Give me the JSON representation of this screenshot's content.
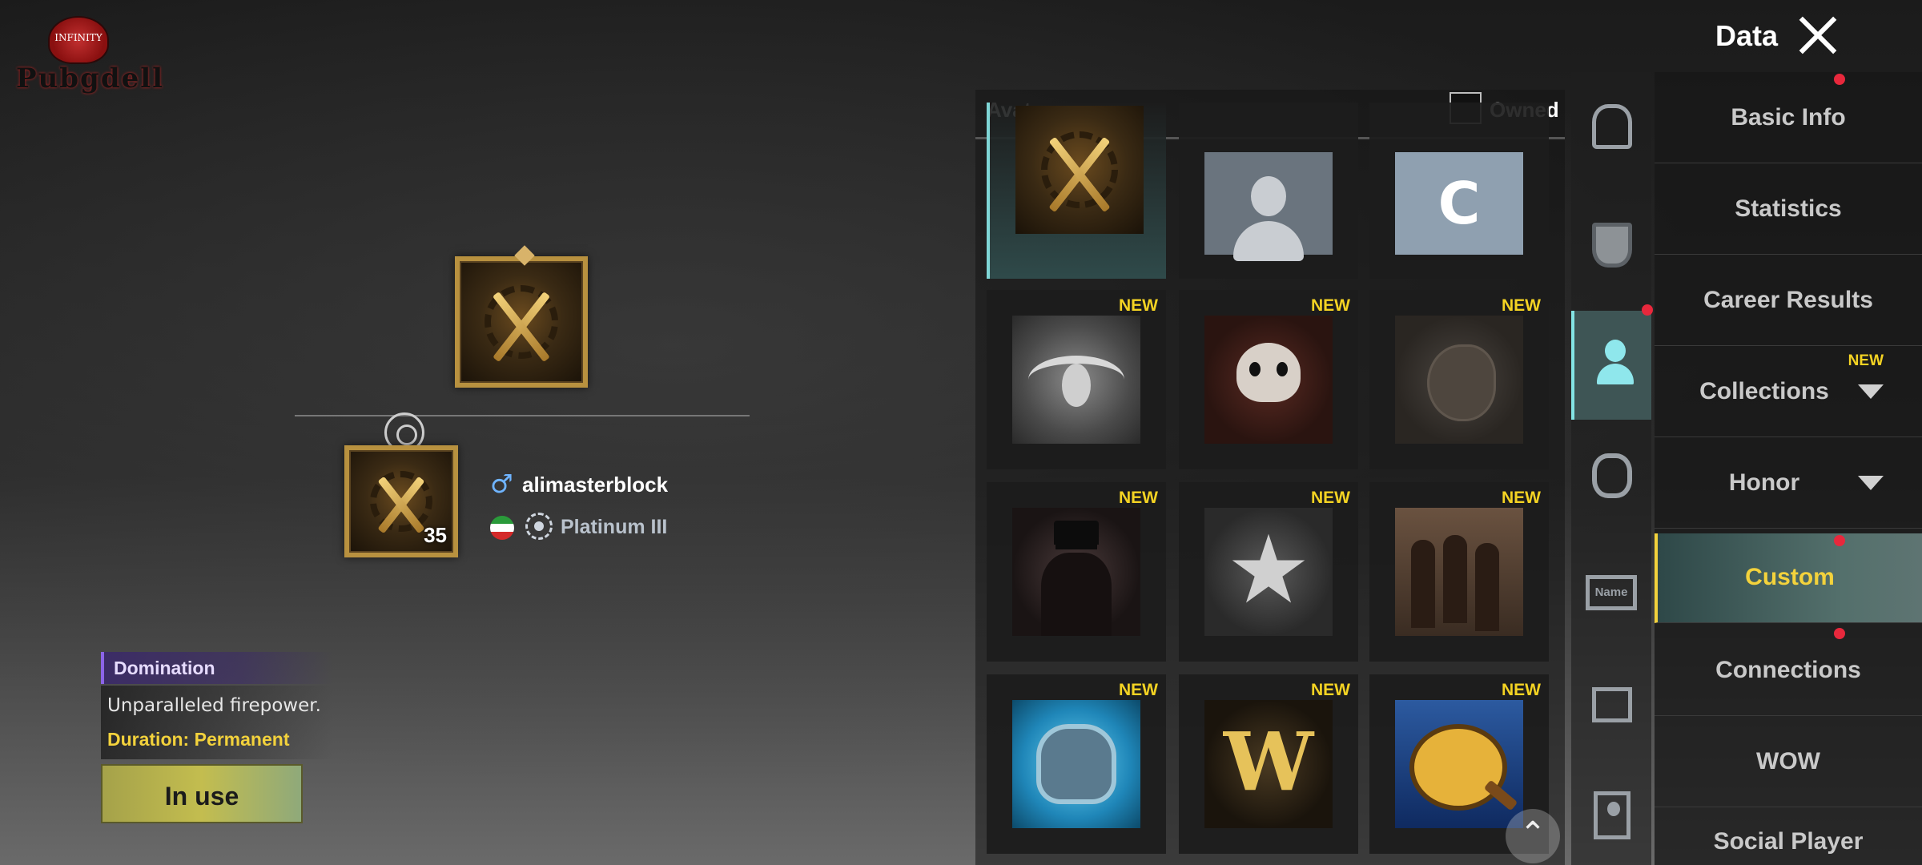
{
  "watermark": {
    "logo_seal": "INFINITY",
    "logo_word": "Pubgdell"
  },
  "header": {
    "title": "Data",
    "close_icon": "close-icon"
  },
  "preview": {
    "level": "35",
    "player_name": "alimasterblock",
    "gender_icon": "male-icon",
    "rank": "Platinum III"
  },
  "item": {
    "name": "Domination",
    "description": "Unparalleled firepower.",
    "duration": "Duration: Permanent",
    "button_label": "In use"
  },
  "avatar_panel": {
    "title": "Avatar",
    "owned_label": "Owned",
    "new_label": "NEW",
    "tiles": [
      {
        "art": "crossed-rifles-icon",
        "new": false,
        "selected": true
      },
      {
        "art": "default-person-icon",
        "new": false,
        "selected": false
      },
      {
        "art": "letter-c-icon",
        "letter": "C",
        "new": false,
        "selected": false
      },
      {
        "art": "silver-wings-icon",
        "new": true,
        "selected": false
      },
      {
        "art": "skull-icon",
        "new": true,
        "selected": false
      },
      {
        "art": "chicken-icon",
        "new": true,
        "selected": false
      },
      {
        "art": "gunman-icon",
        "new": true,
        "selected": false
      },
      {
        "art": "star-medal-icon",
        "new": true,
        "selected": false
      },
      {
        "art": "squad-icon",
        "new": true,
        "selected": false
      },
      {
        "art": "helmet-icon",
        "new": true,
        "selected": false
      },
      {
        "art": "w-emblem-icon",
        "letter": "W",
        "new": true,
        "selected": false
      },
      {
        "art": "frying-pan-icon",
        "new": true,
        "selected": false
      }
    ]
  },
  "tabs": [
    {
      "name": "frame-tab",
      "icon": "frame-icon"
    },
    {
      "name": "shield-tab",
      "icon": "shield-icon"
    },
    {
      "name": "avatar-tab",
      "icon": "person-icon",
      "active": true
    },
    {
      "name": "emblem-tab",
      "icon": "emblem-icon"
    },
    {
      "name": "nameplate-tab",
      "icon": "nameplate-icon",
      "text": "Name"
    },
    {
      "name": "folder-tab",
      "icon": "folder-icon"
    },
    {
      "name": "card-tab",
      "icon": "id-card-icon"
    }
  ],
  "menu": {
    "items": [
      {
        "label": "Basic Info"
      },
      {
        "label": "Statistics"
      },
      {
        "label": "Career Results"
      },
      {
        "label": "Collections",
        "badge": "NEW"
      },
      {
        "label": "Honor"
      },
      {
        "label": "Custom",
        "active": true
      },
      {
        "label": "Connections"
      },
      {
        "label": "WOW"
      },
      {
        "label": "Social Player"
      }
    ]
  },
  "colors": {
    "accent": "#f3d23c",
    "new_badge": "#f4d323",
    "notify_dot": "#e8283c",
    "active_tab": "#83e4e4"
  }
}
